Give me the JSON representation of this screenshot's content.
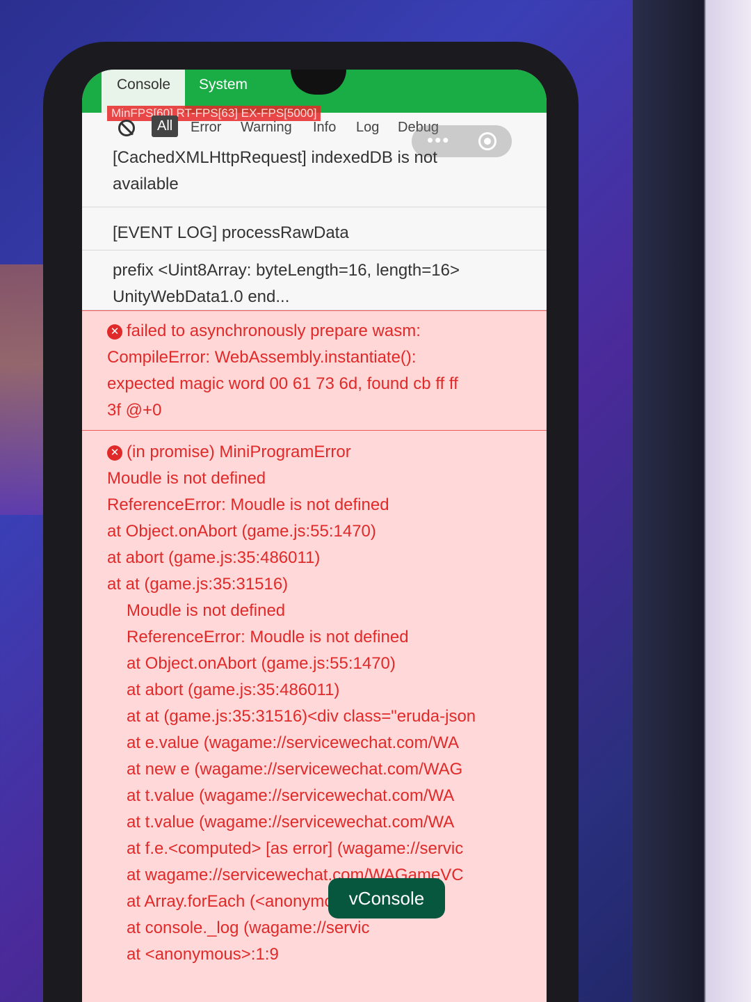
{
  "tabs": {
    "console": "Console",
    "system": "System"
  },
  "fps_overlay": "MinFPS[60] RT-FPS[63] EX-FPS[5000]",
  "filters": {
    "all": "All",
    "error": "Error",
    "warning": "Warning",
    "info": "Info",
    "log": "Log",
    "debug": "Debug"
  },
  "logs": {
    "entry1": {
      "line1": "[CachedXMLHttpRequest] indexedDB is not",
      "line2": "available"
    },
    "entry2": {
      "line1": "[EVENT LOG]  processRawData"
    },
    "entry3": {
      "line1": "prefix <Uint8Array: byteLength=16, length=16>",
      "line2": "UnityWebData1.0 end..."
    },
    "entry4": {
      "line1": "failed to asynchronously prepare wasm:",
      "line2": "CompileError: WebAssembly.instantiate():",
      "line3": "expected magic word 00 61 73 6d, found cb ff ff",
      "line4": "3f @+0"
    },
    "entry5": {
      "lines": [
        "(in promise) MiniProgramError",
        "Moudle is not defined",
        "ReferenceError: Moudle is not defined",
        "at Object.onAbort (game.js:55:1470)",
        "at abort (game.js:35:486011)",
        "at at (game.js:35:31516)",
        "Moudle is not defined",
        "ReferenceError: Moudle is not defined",
        "at Object.onAbort (game.js:55:1470)",
        "at abort (game.js:35:486011)",
        "at at (game.js:35:31516)<div class=\"eruda-json",
        "at e.value (wagame://servicewechat.com/WA",
        "at new e (wagame://servicewechat.com/WAG",
        "at t.value (wagame://servicewechat.com/WA",
        "at t.value (wagame://servicewechat.com/WA",
        "at f.e.<computed> [as error] (wagame://servic",
        "at wagame://servicewechat.com/WAGameVC",
        "at Array.forEach (<anonymous>)",
        "at console._log (wagame://servic",
        "at <anonymous>:1:9"
      ]
    }
  },
  "vconsole_button": "vConsole",
  "colors": {
    "tab_green": "#1aad45",
    "error_red": "#e02a2a",
    "error_bg": "#ffd7d7",
    "vconsole_bg": "#07573f"
  }
}
